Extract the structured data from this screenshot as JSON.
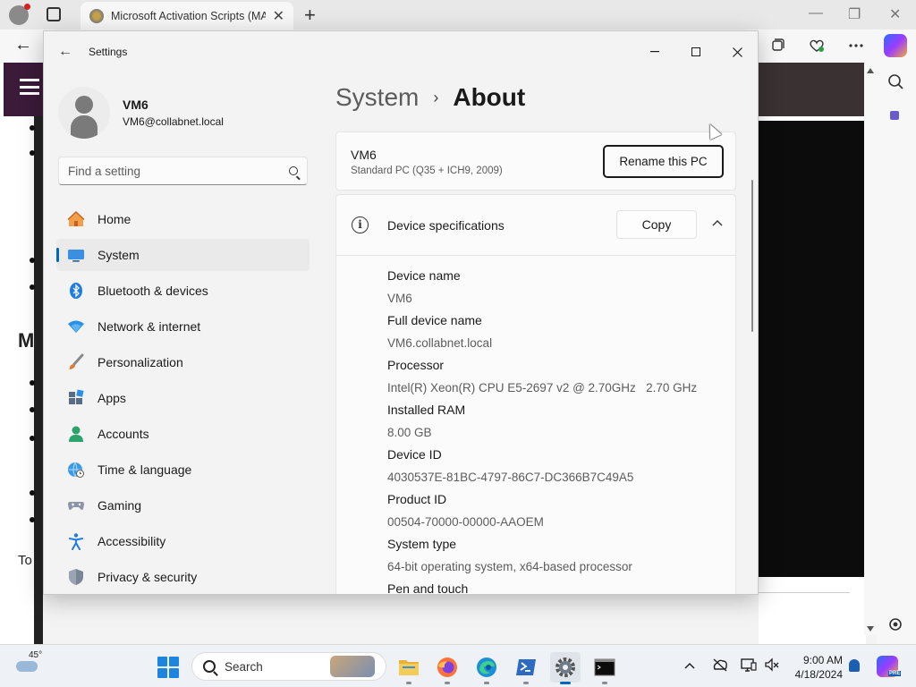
{
  "browser": {
    "tab_title": "Microsoft Activation Scripts (MAS)",
    "tab_close": "✕",
    "new_tab": "+",
    "back": "←",
    "win_min": "—",
    "win_max": "❐",
    "win_close": "✕"
  },
  "webpage": {
    "heading_fragment": "M",
    "text_fragment": "To"
  },
  "settings": {
    "app_title": "Settings",
    "back": "←",
    "user": {
      "name": "VM6",
      "email": "VM6@collabnet.local"
    },
    "search": {
      "placeholder": "Find a setting"
    },
    "nav": [
      {
        "label": "Home",
        "icon": "home-icon"
      },
      {
        "label": "System",
        "icon": "system-icon",
        "active": true
      },
      {
        "label": "Bluetooth & devices",
        "icon": "bluetooth-icon"
      },
      {
        "label": "Network & internet",
        "icon": "wifi-icon"
      },
      {
        "label": "Personalization",
        "icon": "brush-icon"
      },
      {
        "label": "Apps",
        "icon": "apps-icon"
      },
      {
        "label": "Accounts",
        "icon": "accounts-icon"
      },
      {
        "label": "Time & language",
        "icon": "globe-clock-icon"
      },
      {
        "label": "Gaming",
        "icon": "gamepad-icon"
      },
      {
        "label": "Accessibility",
        "icon": "accessibility-icon"
      },
      {
        "label": "Privacy & security",
        "icon": "shield-icon"
      }
    ],
    "breadcrumb": {
      "parent": "System",
      "separator": "›",
      "current": "About"
    },
    "pc": {
      "name": "VM6",
      "model": "Standard PC (Q35 + ICH9, 2009)",
      "rename_label": "Rename this PC"
    },
    "specs": {
      "title": "Device specifications",
      "copy_label": "Copy",
      "chevron": "⌃",
      "items": [
        {
          "label": "Device name",
          "value": "VM6"
        },
        {
          "label": "Full device name",
          "value": "VM6.collabnet.local"
        },
        {
          "label": "Processor",
          "value": "Intel(R) Xeon(R) CPU E5-2697 v2 @ 2.70GHz   2.70 GHz"
        },
        {
          "label": "Installed RAM",
          "value": "8.00 GB"
        },
        {
          "label": "Device ID",
          "value": "4030537E-81BC-4797-86C7-DC366B7C49A5"
        },
        {
          "label": "Product ID",
          "value": "00504-70000-00000-AAOEM"
        },
        {
          "label": "System type",
          "value": "64-bit operating system, x64-based processor"
        },
        {
          "label": "Pen and touch",
          "value": ""
        }
      ]
    }
  },
  "taskbar": {
    "weather_temp": "45°",
    "search_label": "Search",
    "clock_time": "9:00 AM",
    "clock_date": "4/18/2024",
    "copilot_badge": "PRE"
  },
  "colors": {
    "accent": "#0067c0",
    "window_bg": "#f3f3f3",
    "card_bg": "#fbfbfb",
    "secondary_text": "#5c5c5c"
  }
}
